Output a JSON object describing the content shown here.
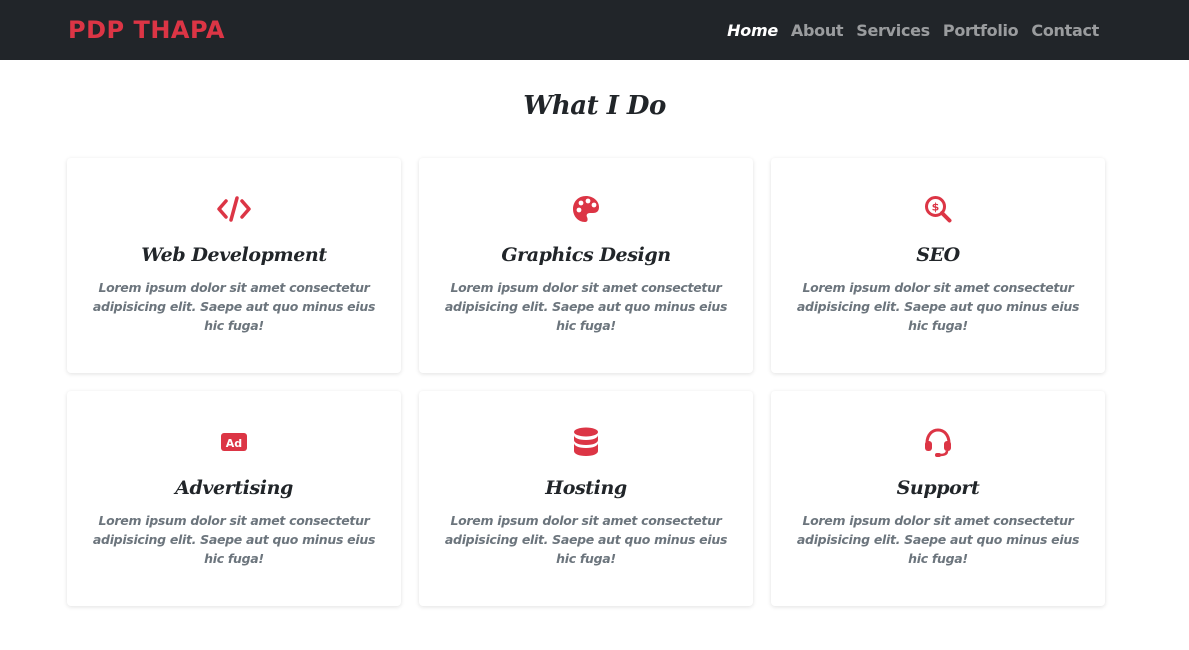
{
  "navbar": {
    "brand": "PDP THAPA",
    "links": [
      {
        "label": "Home",
        "active": true
      },
      {
        "label": "About"
      },
      {
        "label": "Services"
      },
      {
        "label": "Portfolio"
      },
      {
        "label": "Contact"
      }
    ]
  },
  "colors": {
    "accent": "#dc3545",
    "navbar_bg": "#212529",
    "text_dark": "#212529",
    "text_muted": "#6c757d"
  },
  "services": {
    "title": "What I Do",
    "cards": [
      {
        "icon": "code-icon",
        "title": "Web Development",
        "text": "Lorem ipsum dolor sit amet consectetur adipisicing elit. Saepe aut quo minus eius hic fuga!"
      },
      {
        "icon": "palette-icon",
        "title": "Graphics Design",
        "text": "Lorem ipsum dolor sit amet consectetur adipisicing elit. Saepe aut quo minus eius hic fuga!"
      },
      {
        "icon": "search-dollar-icon",
        "title": "SEO",
        "text": "Lorem ipsum dolor sit amet consectetur adipisicing elit. Saepe aut quo minus eius hic fuga!"
      },
      {
        "icon": "ad-icon",
        "title": "Advertising",
        "text": "Lorem ipsum dolor sit amet consectetur adipisicing elit. Saepe aut quo minus eius hic fuga!",
        "icon_text": "Ad"
      },
      {
        "icon": "database-icon",
        "title": "Hosting",
        "text": "Lorem ipsum dolor sit amet consectetur adipisicing elit. Saepe aut quo minus eius hic fuga!"
      },
      {
        "icon": "headset-icon",
        "title": "Support",
        "text": "Lorem ipsum dolor sit amet consectetur adipisicing elit. Saepe aut quo minus eius hic fuga!"
      }
    ]
  }
}
